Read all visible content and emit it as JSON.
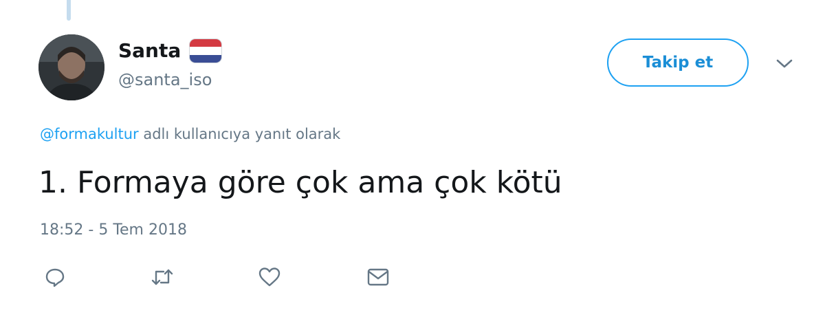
{
  "tweet": {
    "author": {
      "display_name": "Santa",
      "username": "@santa_iso",
      "flag_icon": "netherlands-flag-icon",
      "avatar_icon": "avatar"
    },
    "follow_button_label": "Takip et",
    "menu_icon": "chevron-down-icon",
    "reply_context": {
      "mention": "@formakultur",
      "suffix": " adlı kullanıcıya yanıt olarak"
    },
    "text": "1. Formaya göre çok ama çok kötü",
    "timestamp": "18:52 - 5 Tem 2018",
    "actions": [
      {
        "icon": "reply-icon"
      },
      {
        "icon": "retweet-icon"
      },
      {
        "icon": "like-icon"
      },
      {
        "icon": "direct-message-icon"
      }
    ]
  },
  "colors": {
    "accent": "#1da1f2",
    "secondary_text": "#657786",
    "primary_text": "#14171a",
    "thread_line": "#c5dcee"
  }
}
